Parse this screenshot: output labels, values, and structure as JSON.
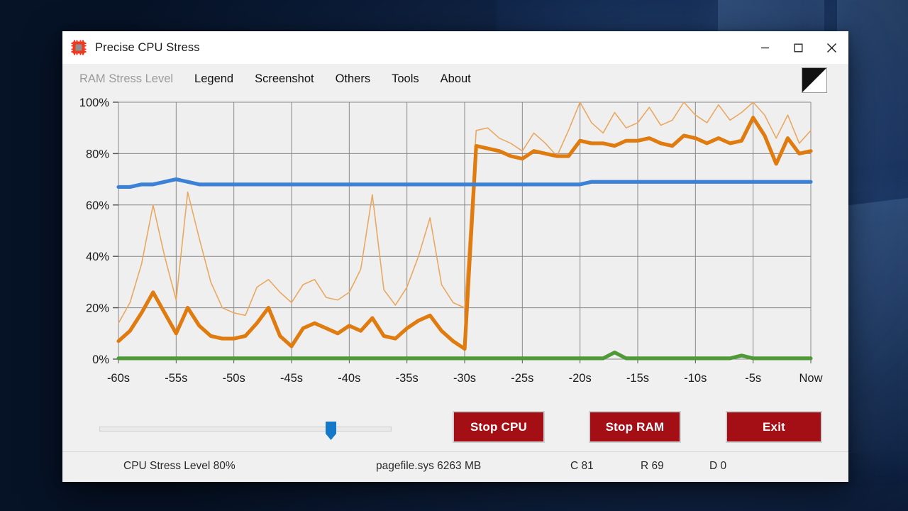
{
  "window": {
    "title": "Precise CPU Stress",
    "icon": "cpu-chip-icon",
    "minimize_label": "—",
    "maximize_label": "□",
    "close_label": "✕"
  },
  "menu": {
    "items": [
      {
        "label": "RAM Stress Level",
        "disabled": true
      },
      {
        "label": "Legend",
        "disabled": false
      },
      {
        "label": "Screenshot",
        "disabled": false
      },
      {
        "label": "Others",
        "disabled": false
      },
      {
        "label": "Tools",
        "disabled": false
      },
      {
        "label": "About",
        "disabled": false
      }
    ],
    "graph_mode_icon": "triangle-fill-icon"
  },
  "controls": {
    "slider": {
      "name": "cpu-stress-level-slider",
      "value": 80,
      "min": 0,
      "max": 100
    },
    "stop_cpu_label": "Stop CPU",
    "stop_ram_label": "Stop RAM",
    "exit_label": "Exit"
  },
  "status": {
    "cpu_stress": "CPU Stress Level 80%",
    "pagefile": "pagefile.sys 6263 MB",
    "c_value": "C 81",
    "r_value": "R 69",
    "d_value": "D 0"
  },
  "colors": {
    "cpu_avg": "#e07b10",
    "cpu_max": "#e9a861",
    "ram": "#3b82d6",
    "disk": "#4e9a37",
    "grid": "#8a8a8a",
    "plot_bg": "#efefef",
    "button_red": "#a30f15",
    "window_bg": "#f0f0f0"
  },
  "chart_data": {
    "type": "line",
    "title": "",
    "xlabel": "",
    "ylabel": "",
    "xlim": [
      -60,
      0
    ],
    "ylim": [
      0,
      100
    ],
    "grid": true,
    "legend": "none",
    "x_tick_labels": [
      "-60s",
      "-55s",
      "-50s",
      "-45s",
      "-40s",
      "-35s",
      "-30s",
      "-25s",
      "-20s",
      "-15s",
      "-10s",
      "-5s",
      "Now"
    ],
    "x_tick_values": [
      -60,
      -55,
      -50,
      -45,
      -40,
      -35,
      -30,
      -25,
      -20,
      -15,
      -10,
      -5,
      0
    ],
    "y_tick_labels": [
      "0%",
      "20%",
      "40%",
      "60%",
      "80%",
      "100%"
    ],
    "y_tick_values": [
      0,
      20,
      40,
      60,
      80,
      100
    ],
    "x": [
      -60,
      -59,
      -58,
      -57,
      -56,
      -55,
      -54,
      -53,
      -52,
      -51,
      -50,
      -49,
      -48,
      -47,
      -46,
      -45,
      -44,
      -43,
      -42,
      -41,
      -40,
      -39,
      -38,
      -37,
      -36,
      -35,
      -34,
      -33,
      -32,
      -31,
      -30,
      -29,
      -28,
      -27,
      -26,
      -25,
      -24,
      -23,
      -22,
      -21,
      -20,
      -19,
      -18,
      -17,
      -16,
      -15,
      -14,
      -13,
      -12,
      -11,
      -10,
      -9,
      -8,
      -7,
      -6,
      -5,
      -4,
      -3,
      -2,
      -1,
      0
    ],
    "series": [
      {
        "name": "CPU max",
        "color": "#e9a861",
        "width": 1.6,
        "values": [
          14,
          22,
          37,
          60,
          40,
          23,
          65,
          47,
          30,
          20,
          18,
          17,
          28,
          31,
          26,
          22,
          29,
          31,
          24,
          23,
          26,
          35,
          64,
          27,
          21,
          28,
          40,
          55,
          29,
          22,
          20,
          89,
          90,
          86,
          84,
          81,
          88,
          84,
          79,
          89,
          100,
          92,
          88,
          96,
          90,
          92,
          98,
          91,
          93,
          100,
          95,
          92,
          99,
          93,
          96,
          100,
          95,
          86,
          95,
          84,
          89
        ]
      },
      {
        "name": "CPU average",
        "color": "#e07b10",
        "width": 5.2,
        "values": [
          7,
          11,
          18,
          26,
          18,
          10,
          20,
          13,
          9,
          8,
          8,
          9,
          14,
          20,
          9,
          5,
          12,
          14,
          12,
          10,
          13,
          11,
          16,
          9,
          8,
          12,
          15,
          17,
          11,
          7,
          4,
          83,
          82,
          81,
          79,
          78,
          81,
          80,
          79,
          79,
          85,
          84,
          84,
          83,
          85,
          85,
          86,
          84,
          83,
          87,
          86,
          84,
          86,
          84,
          85,
          94,
          87,
          76,
          86,
          80,
          81
        ]
      },
      {
        "name": "RAM",
        "color": "#3b82d6",
        "width": 5.2,
        "values": [
          67,
          67,
          68,
          68,
          69,
          70,
          69,
          68,
          68,
          68,
          68,
          68,
          68,
          68,
          68,
          68,
          68,
          68,
          68,
          68,
          68,
          68,
          68,
          68,
          68,
          68,
          68,
          68,
          68,
          68,
          68,
          68,
          68,
          68,
          68,
          68,
          68,
          68,
          68,
          68,
          68,
          69,
          69,
          69,
          69,
          69,
          69,
          69,
          69,
          69,
          69,
          69,
          69,
          69,
          69,
          69,
          69,
          69,
          69,
          69,
          69
        ]
      },
      {
        "name": "Disk",
        "color": "#4e9a37",
        "width": 5.2,
        "values": [
          0.3,
          0.3,
          0.3,
          0.3,
          0.3,
          0.3,
          0.3,
          0.3,
          0.3,
          0.3,
          0.3,
          0.3,
          0.3,
          0.3,
          0.3,
          0.3,
          0.3,
          0.3,
          0.3,
          0.3,
          0.3,
          0.3,
          0.3,
          0.3,
          0.3,
          0.3,
          0.3,
          0.3,
          0.3,
          0.3,
          0.3,
          0.3,
          0.3,
          0.3,
          0.3,
          0.3,
          0.3,
          0.3,
          0.3,
          0.3,
          0.3,
          0.3,
          0.3,
          2.6,
          0.3,
          0.3,
          0.3,
          0.3,
          0.3,
          0.3,
          0.3,
          0.3,
          0.3,
          0.3,
          1.4,
          0.3,
          0.3,
          0.3,
          0.3,
          0.3,
          0.3
        ]
      }
    ]
  }
}
